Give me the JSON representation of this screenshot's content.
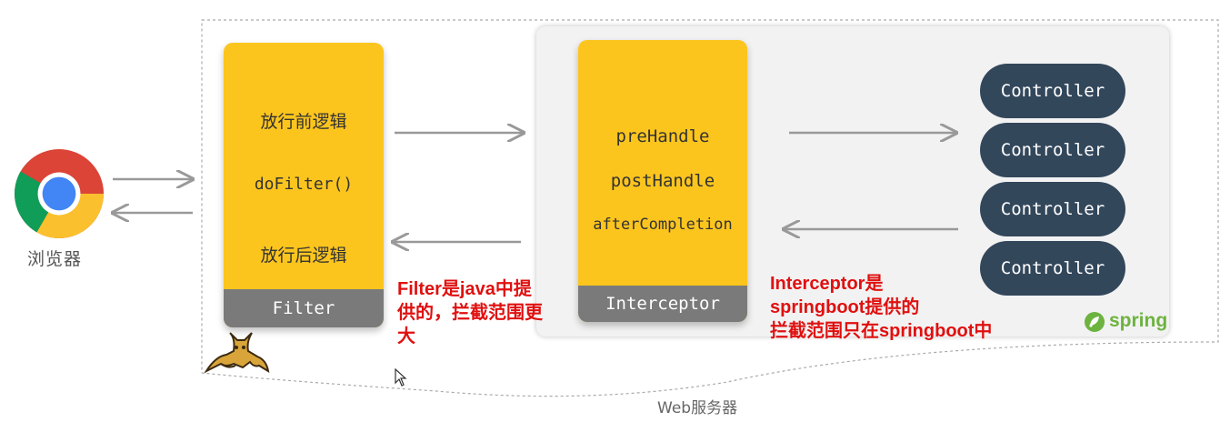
{
  "browser": {
    "label": "浏览器",
    "icon": "chrome-icon"
  },
  "server": {
    "label": "Web服务器",
    "icon": "tomcat-icon"
  },
  "filter": {
    "steps": [
      "放行前逻辑",
      "doFilter()",
      "放行后逻辑"
    ],
    "footer": "Filter",
    "note": "Filter是java中提供的，拦截范围更大"
  },
  "spring": {
    "logo_text": "spring",
    "icon": "spring-leaf-icon"
  },
  "interceptor": {
    "steps": [
      "preHandle",
      "postHandle",
      "afterCompletion"
    ],
    "footer": "Interceptor",
    "note_lines": [
      "Interceptor是",
      "springboot提供的",
      "拦截范围只在springboot中"
    ]
  },
  "controllers": [
    "Controller",
    "Controller",
    "Controller",
    "Controller"
  ],
  "colors": {
    "card_yellow": "#fcc51e",
    "footer_gray": "#7a7a7a",
    "controller_navy": "#33475b",
    "note_red": "#e01010",
    "spring_green": "#6db33f",
    "arrow_gray": "#999999"
  }
}
